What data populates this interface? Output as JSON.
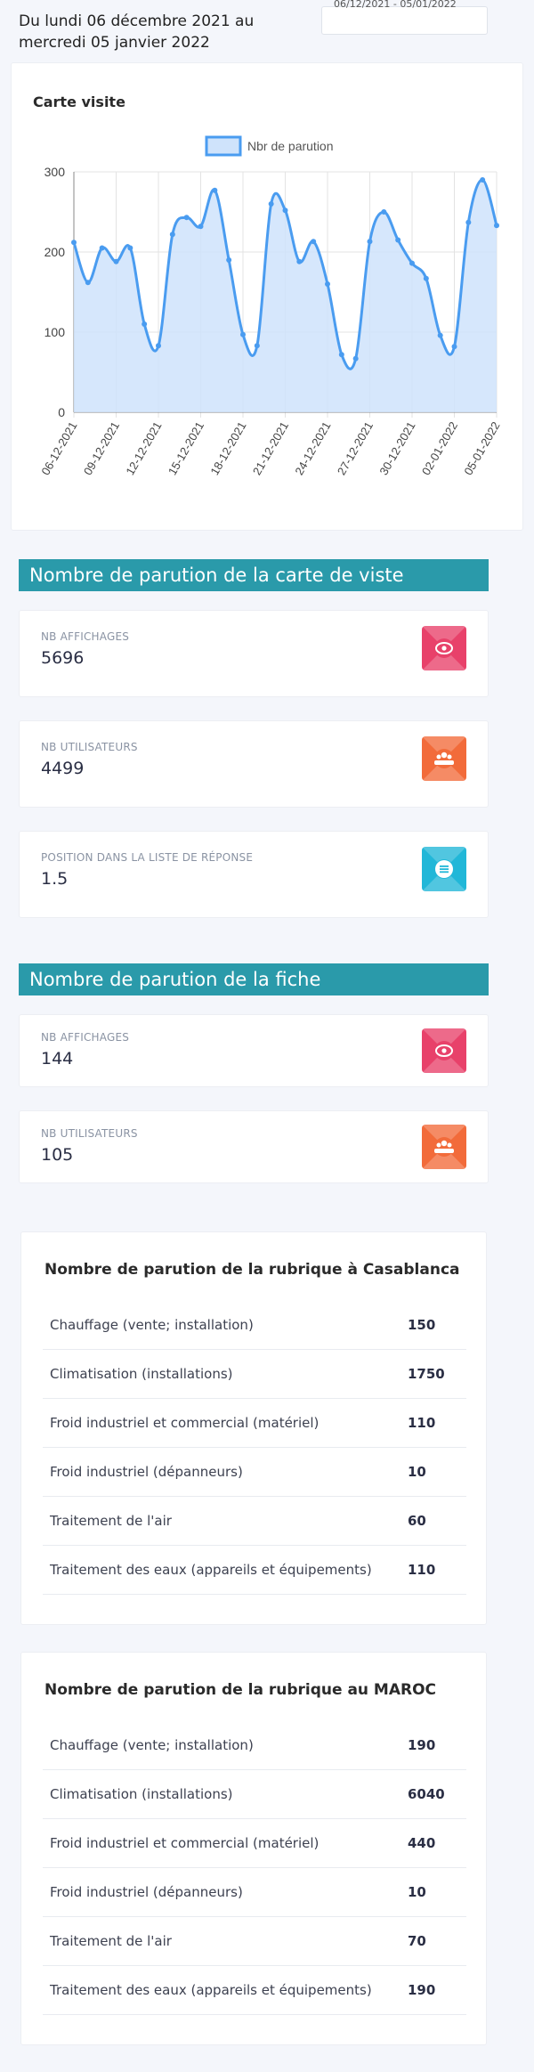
{
  "header": {
    "period": "Du lundi 06 décembre 2021 au mercredi 05 janvier 2022",
    "date_range": "06/12/2021 - 05/01/2022"
  },
  "chart_card": {
    "title": "Carte visite"
  },
  "chart_data": {
    "type": "area",
    "legend": [
      "Nbr de parution"
    ],
    "legend_position": "top-center",
    "ylim": [
      0,
      300
    ],
    "y_ticks": [
      "0",
      "100",
      "200",
      "300"
    ],
    "x_tick_labels": [
      "06-12-2021",
      "09-12-2021",
      "12-12-2021",
      "15-12-2021",
      "18-12-2021",
      "21-12-2021",
      "24-12-2021",
      "27-12-2021",
      "30-12-2021",
      "02-01-2022",
      "05-01-2022"
    ],
    "grid": true,
    "colors": {
      "line": "#4a9cf0",
      "fill": "#cfe3fb"
    },
    "series": [
      {
        "name": "Nbr de parution",
        "x": [
          "06-12-2021",
          "07-12-2021",
          "08-12-2021",
          "09-12-2021",
          "10-12-2021",
          "11-12-2021",
          "12-12-2021",
          "13-12-2021",
          "14-12-2021",
          "15-12-2021",
          "16-12-2021",
          "17-12-2021",
          "18-12-2021",
          "19-12-2021",
          "20-12-2021",
          "21-12-2021",
          "22-12-2021",
          "23-12-2021",
          "24-12-2021",
          "25-12-2021",
          "26-12-2021",
          "27-12-2021",
          "28-12-2021",
          "29-12-2021",
          "30-12-2021",
          "31-12-2021",
          "01-01-2022",
          "02-01-2022",
          "03-01-2022",
          "04-01-2022",
          "05-01-2022"
        ],
        "values": [
          212,
          162,
          205,
          188,
          205,
          110,
          83,
          222,
          243,
          232,
          277,
          190,
          97,
          83,
          260,
          252,
          188,
          213,
          160,
          72,
          67,
          213,
          250,
          215,
          186,
          167,
          96,
          82,
          237,
          290,
          233
        ]
      }
    ]
  },
  "sections": {
    "carte": "Nombre de parution de la carte de viste",
    "fiche": "Nombre de parution de la fiche"
  },
  "stats_carte": [
    {
      "label": "NB AFFICHAGES",
      "value": "5696",
      "icon": "eye-icon",
      "color": "#e8416a"
    },
    {
      "label": "NB UTILISATEURS",
      "value": "4499",
      "icon": "users-icon",
      "color": "#f26b3a"
    },
    {
      "label": "POSITION DANS LA LISTE DE RÉPONSE",
      "value": "1.5",
      "icon": "list-icon",
      "color": "#21b7d8"
    }
  ],
  "stats_fiche": [
    {
      "label": "NB AFFICHAGES",
      "value": "144",
      "icon": "eye-icon",
      "color": "#e8416a"
    },
    {
      "label": "NB UTILISATEURS",
      "value": "105",
      "icon": "users-icon",
      "color": "#f26b3a"
    }
  ],
  "table_casablanca": {
    "title": "Nombre de parution de la rubrique à Casablanca",
    "rows": [
      {
        "name": "Chauffage (vente; installation)",
        "value": "150"
      },
      {
        "name": "Climatisation (installations)",
        "value": "1750"
      },
      {
        "name": "Froid industriel et commercial (matériel)",
        "value": "110"
      },
      {
        "name": "Froid industriel (dépanneurs)",
        "value": "10"
      },
      {
        "name": "Traitement de l'air",
        "value": "60"
      },
      {
        "name": "Traitement des eaux (appareils et équipements)",
        "value": "110"
      }
    ]
  },
  "table_maroc": {
    "title": "Nombre de parution de la rubrique au MAROC",
    "rows": [
      {
        "name": "Chauffage (vente; installation)",
        "value": "190"
      },
      {
        "name": "Climatisation (installations)",
        "value": "6040"
      },
      {
        "name": "Froid industriel et commercial (matériel)",
        "value": "440"
      },
      {
        "name": "Froid industriel (dépanneurs)",
        "value": "10"
      },
      {
        "name": "Traitement de l'air",
        "value": "70"
      },
      {
        "name": "Traitement des eaux (appareils et équipements)",
        "value": "190"
      }
    ]
  }
}
